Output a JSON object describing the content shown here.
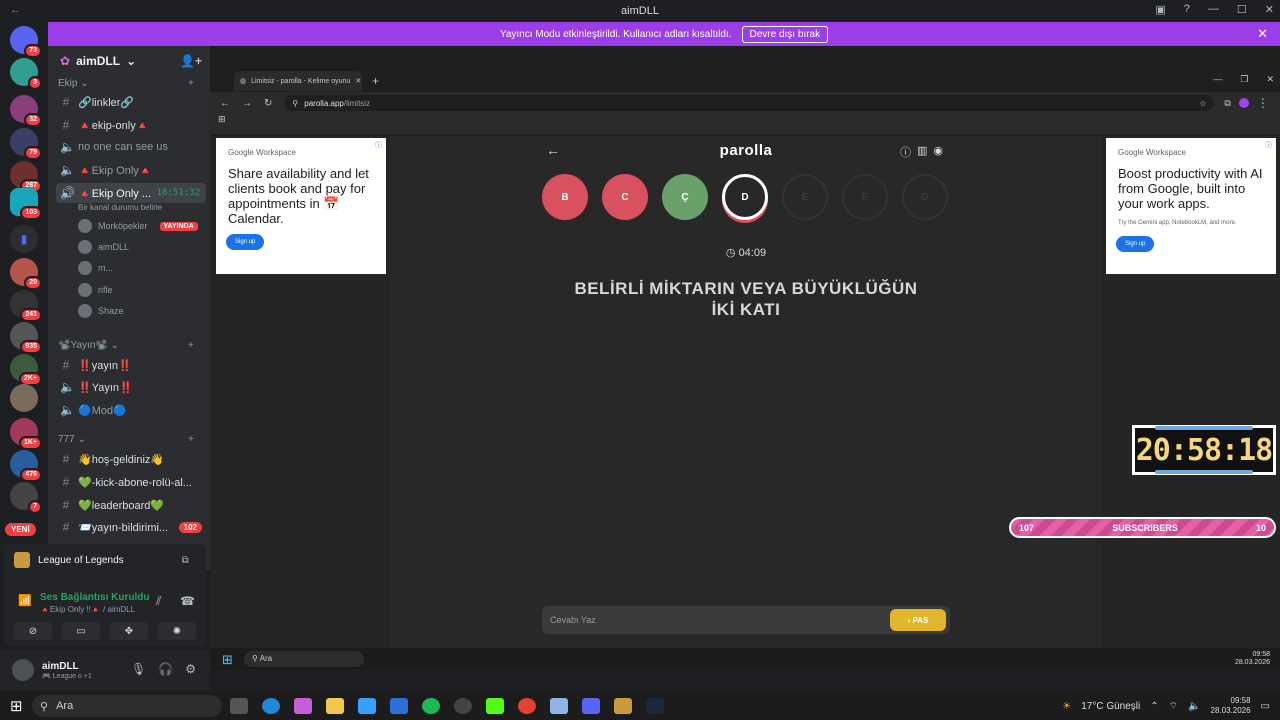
{
  "window": {
    "title": "aimDLL"
  },
  "banner": {
    "text": "Yayıncı Modu etkinleştirildi. Kullanıcı adları kısaltıldı.",
    "button": "Devre dışı bırak"
  },
  "servers": [
    {
      "badge": "73"
    },
    {
      "badge": "3"
    },
    {
      "badge": "32"
    },
    {
      "badge": "79"
    },
    {
      "badge": "287"
    },
    {
      "badge": "103"
    },
    {
      "badge": ""
    },
    {
      "badge": "20"
    },
    {
      "badge": "241"
    },
    {
      "badge": "935"
    },
    {
      "badge": "2K+"
    },
    {
      "badge": ""
    },
    {
      "badge": "1K+"
    },
    {
      "badge": "476"
    },
    {
      "badge": "7"
    }
  ],
  "new_label": "YENİ",
  "guild": {
    "name": "aimDLL"
  },
  "categories": {
    "ekip": "Ekip",
    "yayin": "📽️Yayın📽️",
    "c777": "777"
  },
  "channels": {
    "linkler": "🔗linkler🔗",
    "ekip_only": "🔺ekip-only🔺",
    "no_one": "no one can see us",
    "ekip_only_voice": "🔺Ekip Only🔺",
    "ekip_only_active": "🔺Ekip Only ...",
    "active_time": "18:51:32",
    "status_sub": "Bir kanal durumu belirle",
    "yayin1": "‼️yayın‼️",
    "yayin2": "‼️Yayın‼️",
    "mod": "🔵Mod🔵",
    "hos": "👋hoş-geldiniz👋",
    "kick": "💚-kick-abone-rolü-al...",
    "leaderboard": "💚leaderboard💚",
    "bildirim": "📨yayın-bildirimi...",
    "bildirim_count": "102"
  },
  "members": [
    {
      "name": "Morköpekler",
      "live": "YAYINDA"
    },
    {
      "name": "aimDLL"
    },
    {
      "name": "m..."
    },
    {
      "name": "rifle"
    },
    {
      "name": "Shaze"
    }
  ],
  "activity": {
    "game": "League of Legends"
  },
  "voice": {
    "status": "Ses Bağlantısı Kuruldu",
    "channel": "🔺Ekip Only !!🔺 / aimDLL"
  },
  "user": {
    "name": "aimDLL",
    "status": "🎮 League o +1"
  },
  "browser": {
    "tab_title": "Limitsiz - parolla - Kelime oyunu",
    "url_host": "parolla.app",
    "url_path": "/limitsiz"
  },
  "ads": {
    "left": {
      "brand": "Google Workspace",
      "headline": "Share availability and let clients book and pay for appointments in 📅Calendar.",
      "cta": "Sign up"
    },
    "right": {
      "brand": "Google Workspace",
      "headline": "Boost productivity with AI from Google, built into your work apps.",
      "small": "Try the Gemini app, NotebookLM, and more.",
      "cta": "Sign up"
    }
  },
  "game": {
    "title": "parolla",
    "letters": [
      {
        "l": "B",
        "state": "wrong"
      },
      {
        "l": "C",
        "state": "wrong"
      },
      {
        "l": "Ç",
        "state": "right"
      },
      {
        "l": "D",
        "state": "current"
      },
      {
        "l": "E",
        "state": "todo"
      },
      {
        "l": "F",
        "state": "todo"
      },
      {
        "l": "G",
        "state": "todo"
      }
    ],
    "timer": "04:09",
    "question_line1": "BELİRLİ MİKTARIN VEYA BÜYÜKLÜĞÜN",
    "question_line2": "İKİ KATI",
    "answer_placeholder": "Cevabı Yaz",
    "pass": "PAS"
  },
  "inner_taskbar": {
    "search": "Ara",
    "time": "09:58",
    "date": "28.03.2026"
  },
  "overlay": {
    "clock": "20:58:18",
    "subs_left": "107",
    "subs_label": "SUBSCRIBERS",
    "subs_right": "10"
  },
  "taskbar": {
    "search": "Ara",
    "weather": "17°C Güneşli",
    "time": "09:58",
    "date": "28.03.2026"
  }
}
